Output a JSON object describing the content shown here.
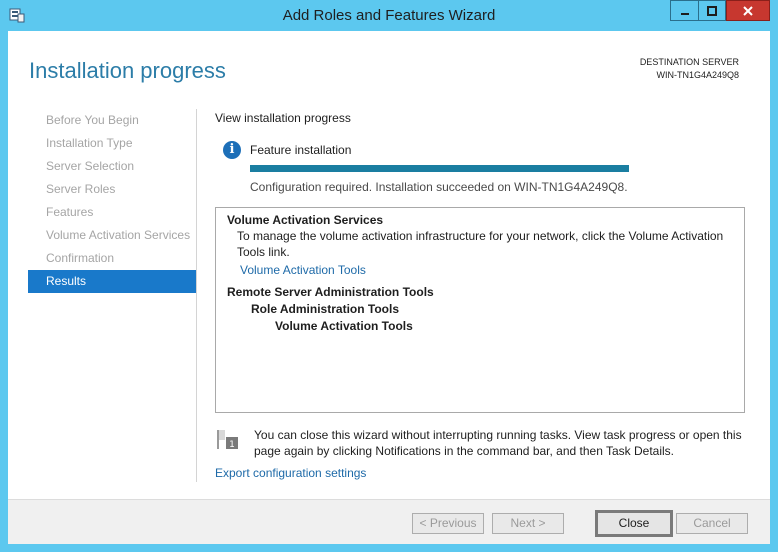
{
  "window": {
    "title": "Add Roles and Features Wizard",
    "title_bar_color": "#5cc8ef",
    "close_color": "#c7372f"
  },
  "page": {
    "heading": "Installation progress",
    "destination_label": "DESTINATION SERVER",
    "destination_server": "WIN-TN1G4A249Q8"
  },
  "nav": {
    "items": [
      {
        "label": "Before You Begin",
        "state": "disabled"
      },
      {
        "label": "Installation Type",
        "state": "disabled"
      },
      {
        "label": "Server Selection",
        "state": "disabled"
      },
      {
        "label": "Server Roles",
        "state": "disabled"
      },
      {
        "label": "Features",
        "state": "disabled"
      },
      {
        "label": "Volume Activation Services",
        "state": "disabled"
      },
      {
        "label": "Confirmation",
        "state": "disabled"
      },
      {
        "label": "Results",
        "state": "active"
      }
    ],
    "active_color": "#1979ca"
  },
  "main": {
    "section_title": "View installation progress",
    "info_icon": "info-icon",
    "feature_title": "Feature installation",
    "progress": 1.0,
    "progress_color": "#1a7ea1",
    "status": "Configuration required. Installation succeeded on WIN-TN1G4A249Q8.",
    "results": {
      "vas_heading": "Volume Activation Services",
      "vas_desc": "To manage the volume activation infrastructure for your network, click the Volume Activation Tools link.",
      "vas_link": "Volume Activation Tools",
      "rsat_heading": "Remote Server Administration Tools",
      "rat_heading": "Role Administration Tools",
      "vat_heading": "Volume Activation Tools"
    },
    "note_icon": "flag-notification-icon",
    "note_text": "You can close this wizard without interrupting running tasks. View task progress or open this page again by clicking Notifications in the command bar, and then Task Details.",
    "export_link": "Export configuration settings"
  },
  "footer": {
    "previous": "< Previous",
    "next": "Next >",
    "close": "Close",
    "cancel": "Cancel",
    "highlight_color": "#e0141b"
  }
}
